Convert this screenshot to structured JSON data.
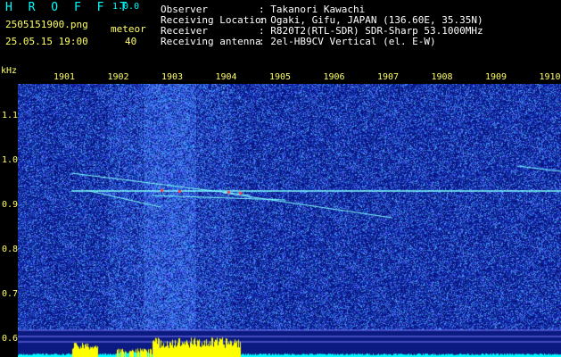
{
  "header": {
    "logo": "H R O F F T",
    "version": "1.0.0",
    "filename": "2505151900.png",
    "datetime": "25.05.15 19:00",
    "meteor_label": "meteor",
    "meteor_count": "40"
  },
  "info": [
    {
      "label": "Observer",
      "value": ": Takanori Kawachi"
    },
    {
      "label": "Receiving Location",
      "value": ": Ogaki, Gifu, JAPAN (136.60E, 35.35N)"
    },
    {
      "label": "Receiver",
      "value": ": R820T2(RTL-SDR) SDR-Sharp 53.1000MHz"
    },
    {
      "label": "Receiving antenna",
      "value": ": 2el-HB9CV Vertical (el. E-W)"
    }
  ],
  "chart_data": {
    "type": "heatmap",
    "ylabel": "kHz",
    "x_ticks": [
      "1901",
      "1902",
      "1903",
      "1904",
      "1905",
      "1906",
      "1907",
      "1908",
      "1909",
      "1910"
    ],
    "y_ticks": [
      "1.1",
      "1.0",
      "0.9",
      "0.8",
      "0.7",
      "0.6"
    ],
    "carrier_khz": 0.93,
    "palette": {
      "background": "#0a1a80",
      "noise": "#3050ff",
      "trace": "#80ffff",
      "peak": "#ff4040",
      "activity": "#ffff00",
      "baseline": "#00ffff"
    }
  }
}
